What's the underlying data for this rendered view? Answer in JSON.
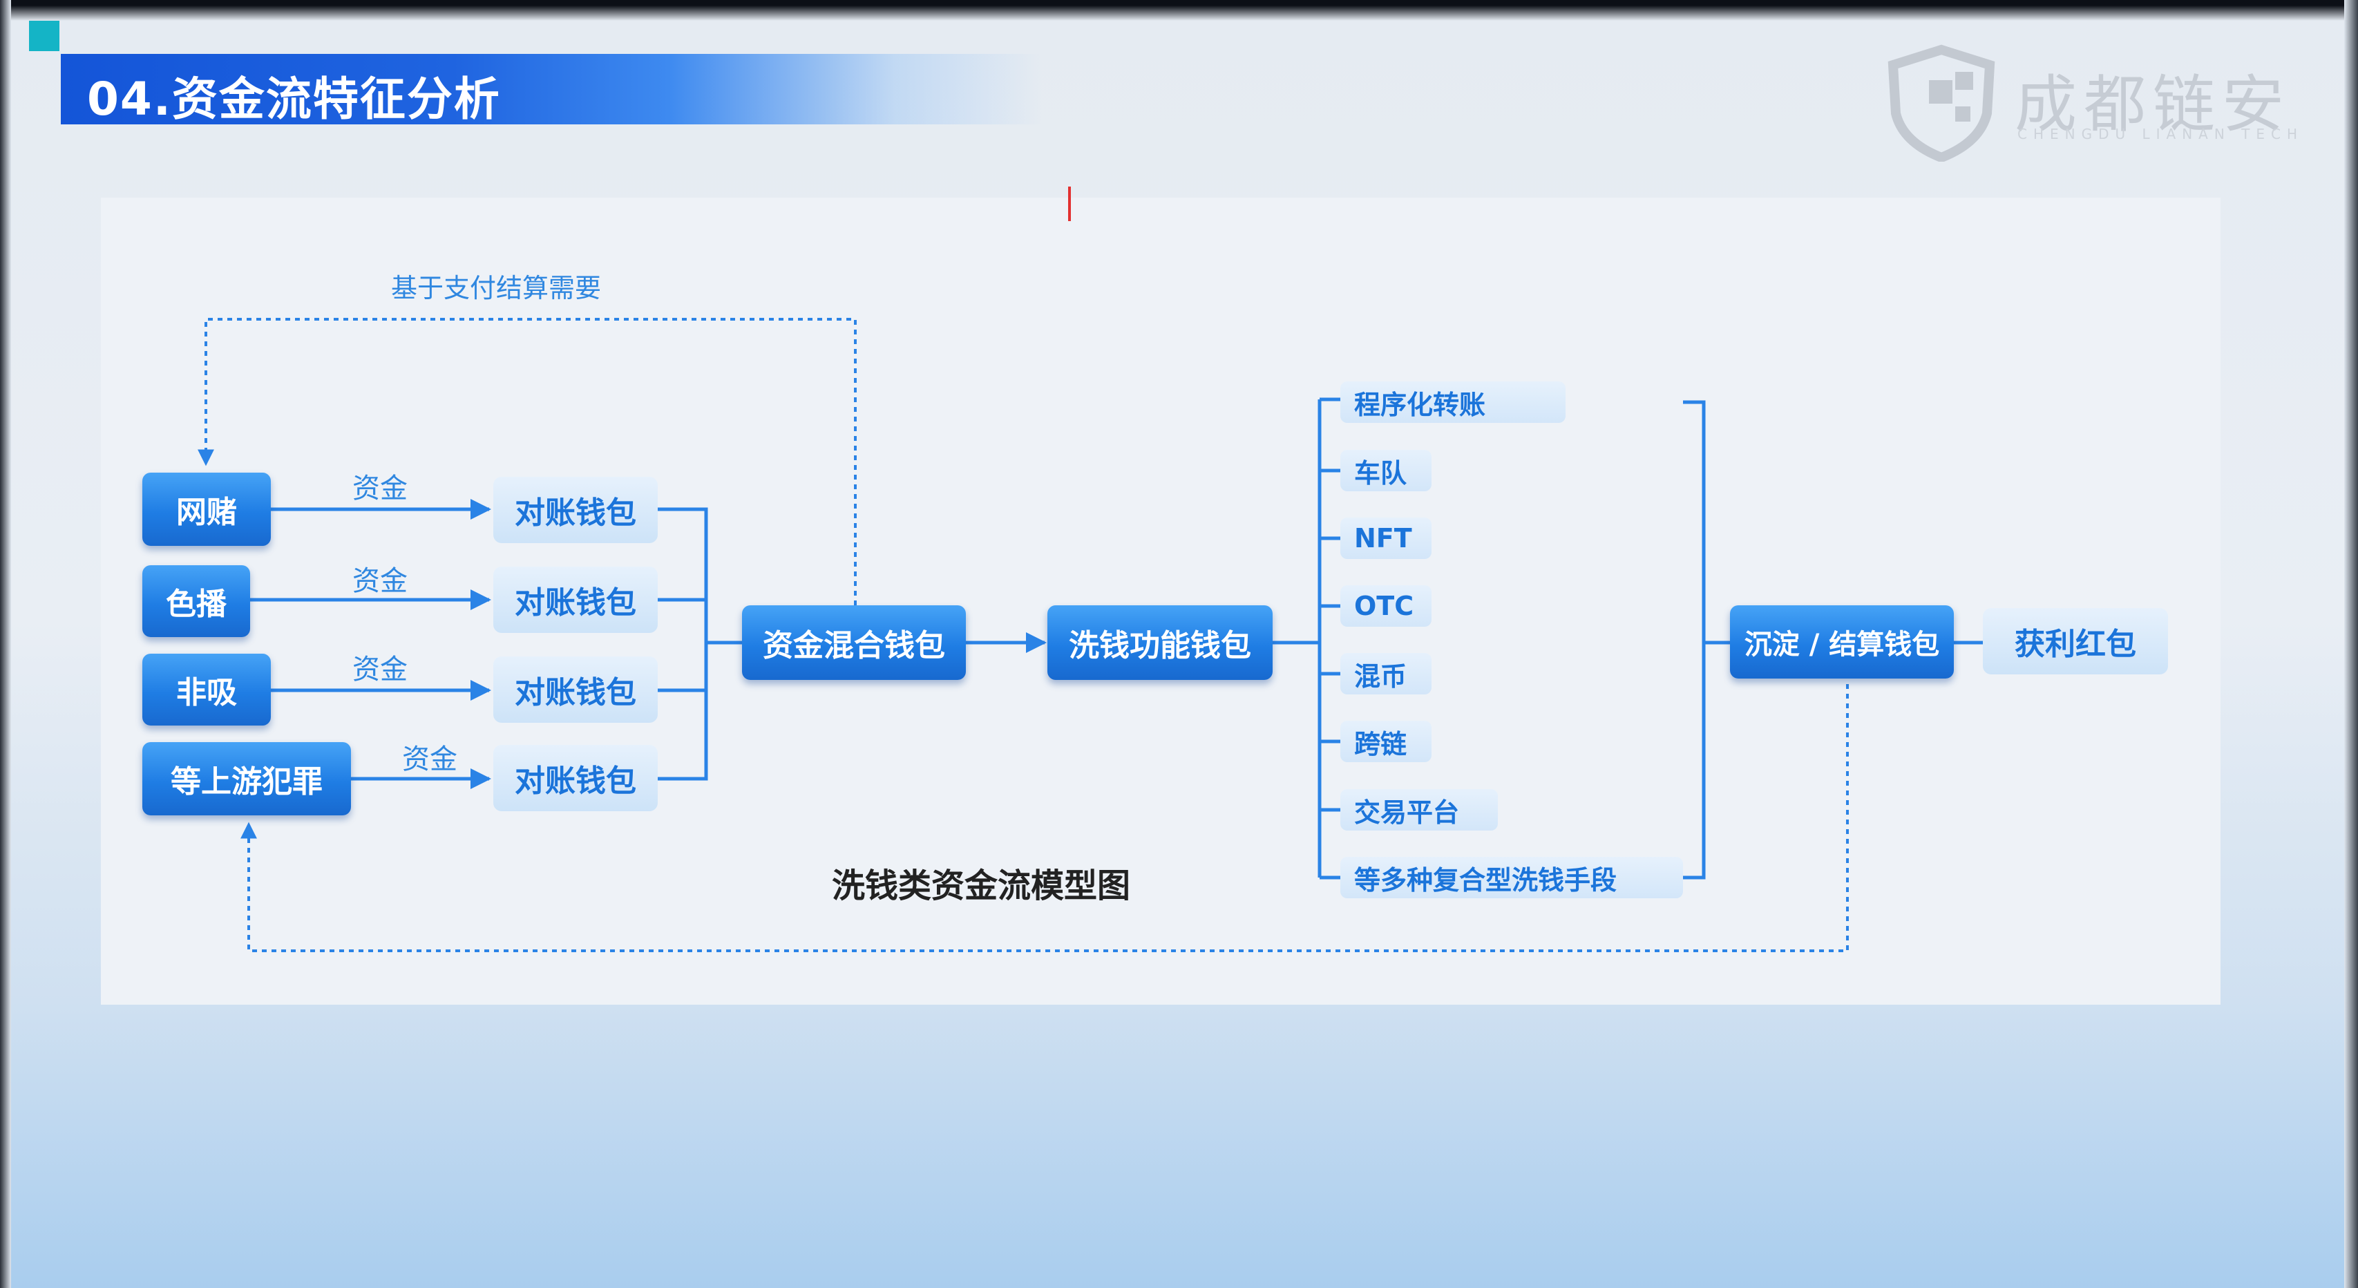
{
  "slide": {
    "title": "04.资金流特征分析",
    "accent_color": "#14b4c6",
    "title_bar_color": "#1455d8"
  },
  "logo": {
    "name": "成都链安",
    "subtitle": "CHENGDU LIANAN TECH",
    "icon": "shield-icon"
  },
  "diagram": {
    "caption": "洗钱类资金流模型图",
    "feedback_top_label": "基于支付结算需要",
    "sources": [
      "网赌",
      "色播",
      "非吸",
      "等上游犯罪"
    ],
    "edge_labels": [
      "资金",
      "资金",
      "资金",
      "资金"
    ],
    "reconcile_wallets": [
      "对账钱包",
      "对账钱包",
      "对账钱包",
      "对账钱包"
    ],
    "mixing_wallet": "资金混合钱包",
    "laundering_wallet": "洗钱功能钱包",
    "methods": [
      "程序化转账",
      "车队",
      "NFT",
      "OTC",
      "混币",
      "跨链",
      "交易平台",
      "等多种复合型洗钱手段"
    ],
    "settlement_wallet": "沉淀 / 结算钱包",
    "profit": "获利红包",
    "node_dark_color": "#1f7de4",
    "node_light_color": "#cde3f8",
    "line_color": "#2a83e6"
  }
}
